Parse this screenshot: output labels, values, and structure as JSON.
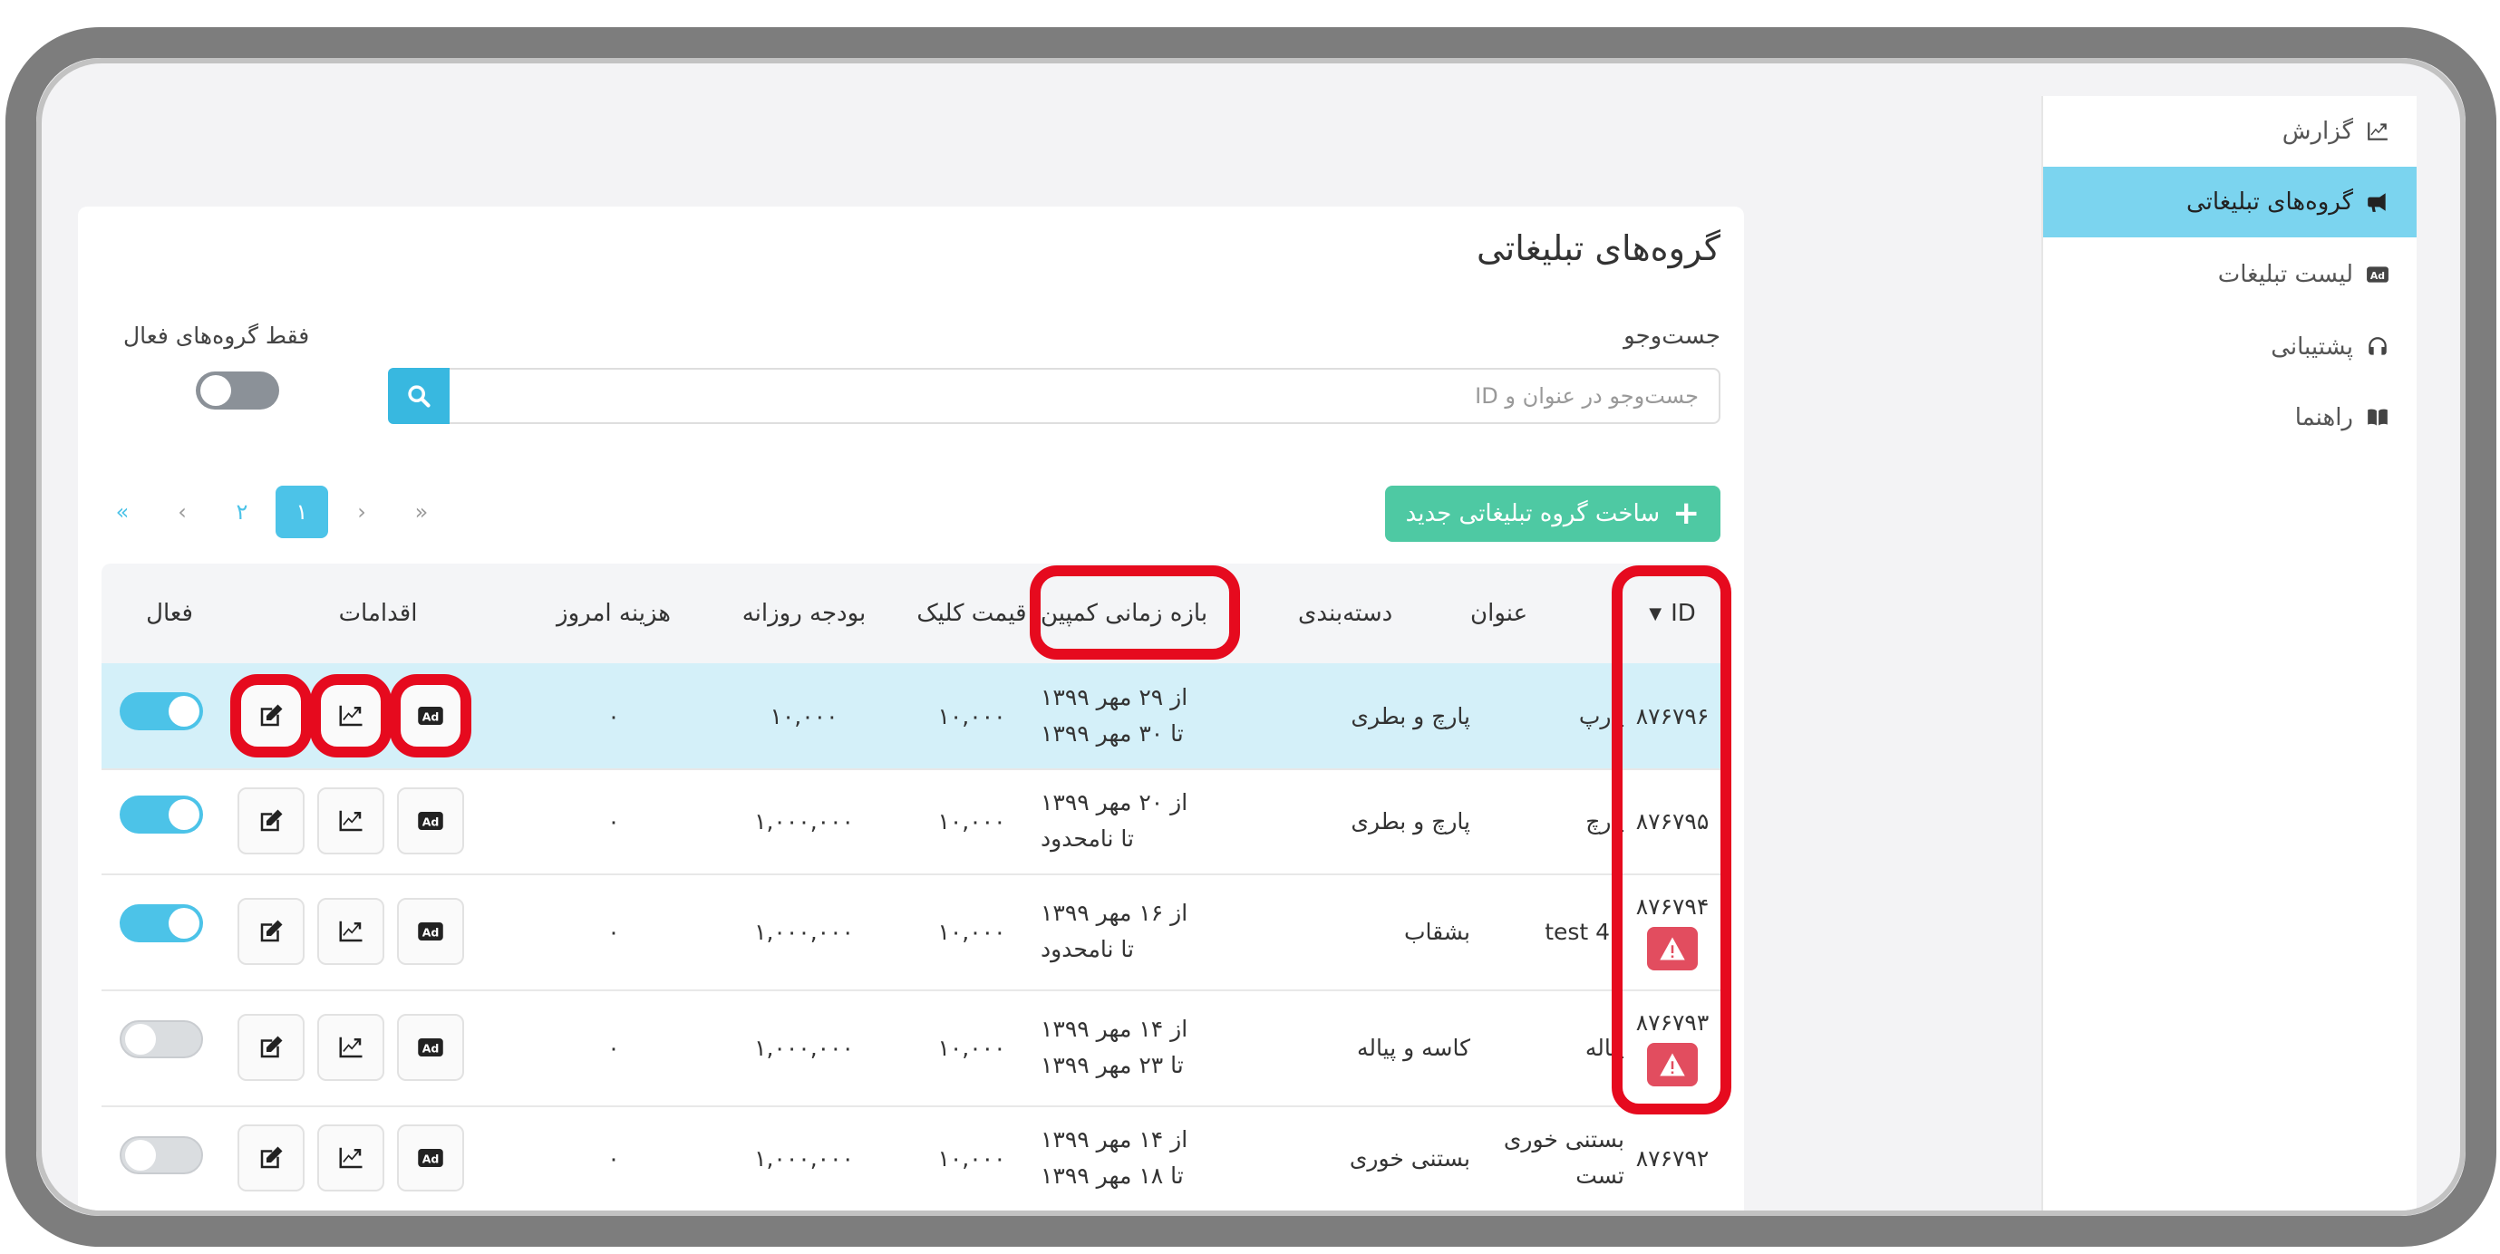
{
  "sidebar": {
    "items": [
      {
        "label": "گزارش",
        "icon": "chart-line-icon",
        "active": false
      },
      {
        "label": "گروه‌های تبلیغاتی",
        "icon": "bullhorn-icon",
        "active": true
      },
      {
        "label": "لیست تبلیغات",
        "icon": "ad-icon",
        "active": false
      },
      {
        "label": "پشتیبانی",
        "icon": "headset-icon",
        "active": false
      },
      {
        "label": "راهنما",
        "icon": "book-icon",
        "active": false
      }
    ]
  },
  "page": {
    "title": "گروه‌های تبلیغاتی",
    "search_label": "جست‌وجو",
    "search_placeholder": "جست‌وجو در عنوان و ID",
    "active_only_label": "فقط گروه‌های فعال",
    "active_only_on": false,
    "new_button": "ساخت گروه تبلیغاتی جدید"
  },
  "pagination": {
    "first": "«",
    "prev": "‹",
    "pages": [
      "۱",
      "۲"
    ],
    "current": "۱",
    "next": "›",
    "last": "»"
  },
  "table": {
    "headers": {
      "id": "ID",
      "title": "عنوان",
      "category": "دسته‌بندی",
      "period": "بازه زمانی کمپین",
      "cpc": "قیمت کلیک",
      "daily_budget": "بودجه روزانه",
      "today_cost": "هزینه امروز",
      "actions": "اقدامات",
      "active": "فعال"
    },
    "sort_indicator": "▼",
    "rows": [
      {
        "id": "۸۷۶۷۹۶",
        "title": "پارپ",
        "category": "پارچ و بطری",
        "from": "از ۲۹ مهر ۱۳۹۹",
        "to": "تا ۳۰ مهر ۱۳۹۹",
        "cpc": "۱۰,۰۰۰",
        "daily_budget": "۱۰,۰۰۰",
        "today_cost": "۰",
        "active": true,
        "warning": false,
        "highlight": true
      },
      {
        "id": "۸۷۶۷۹۵",
        "title": "پارچ",
        "category": "پارچ و بطری",
        "from": "از ۲۰ مهر ۱۳۹۹",
        "to": "تا نامحدود",
        "cpc": "۱۰,۰۰۰",
        "daily_budget": "۱,۰۰۰,۰۰۰",
        "today_cost": "۰",
        "active": true,
        "warning": false,
        "highlight": false
      },
      {
        "id": "۸۷۶۷۹۴",
        "title": "test 45",
        "category": "بشقاب",
        "from": "از ۱۶ مهر ۱۳۹۹",
        "to": "تا نامحدود",
        "cpc": "۱۰,۰۰۰",
        "daily_budget": "۱,۰۰۰,۰۰۰",
        "today_cost": "۰",
        "active": true,
        "warning": true,
        "highlight": false
      },
      {
        "id": "۸۷۶۷۹۳",
        "title": "پیاله",
        "category": "کاسه و پیاله",
        "from": "از ۱۴ مهر ۱۳۹۹",
        "to": "تا ۲۳ مهر ۱۳۹۹",
        "cpc": "۱۰,۰۰۰",
        "daily_budget": "۱,۰۰۰,۰۰۰",
        "today_cost": "۰",
        "active": false,
        "warning": true,
        "highlight": false
      },
      {
        "id": "۸۷۶۷۹۲",
        "title": "بستنی خوری تست",
        "category": "بستنی خوری",
        "from": "از ۱۴ مهر ۱۳۹۹",
        "to": "تا ۱۸ مهر ۱۳۹۹",
        "cpc": "۱۰,۰۰۰",
        "daily_budget": "۱,۰۰۰,۰۰۰",
        "today_cost": "۰",
        "active": false,
        "warning": false,
        "highlight": false
      }
    ]
  },
  "colors": {
    "accent": "#4cc3e8",
    "success": "#4ec9a3",
    "danger": "#e24d5f",
    "highlight_row": "#d4f0f9",
    "annotation": "#e60a1e"
  }
}
